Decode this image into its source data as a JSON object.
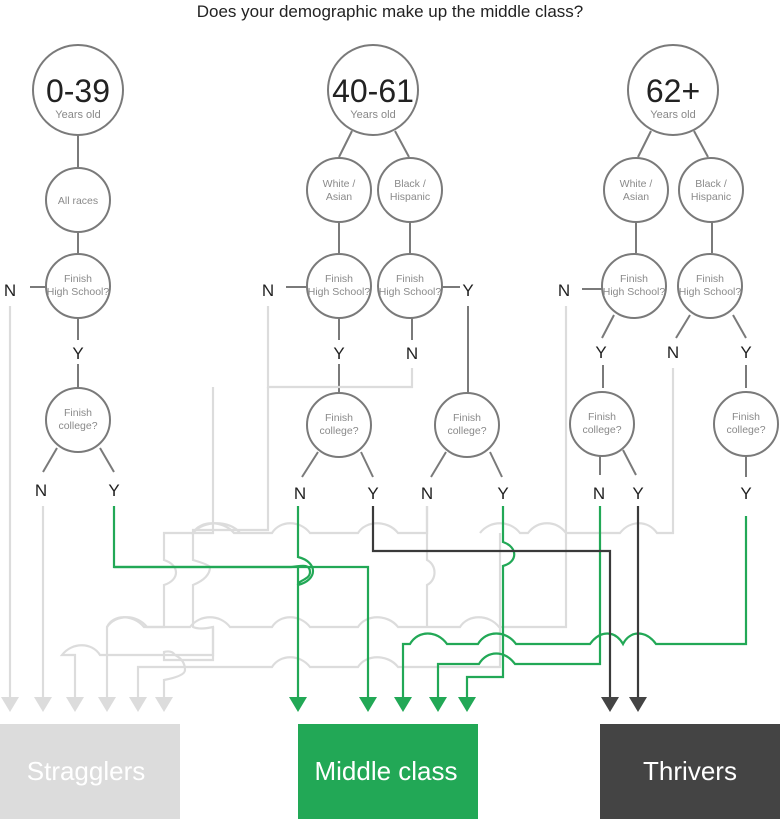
{
  "title": "Does your demographic make up the middle class?",
  "colors": {
    "stragglers": "#dcdcdc",
    "middle_class": "#22a856",
    "thrivers": "#444444",
    "node_stroke": "#7a7a7a"
  },
  "age_groups": [
    {
      "label": "0-39",
      "sub": "Years old"
    },
    {
      "label": "40-61",
      "sub": "Years old"
    },
    {
      "label": "62+",
      "sub": "Years old"
    }
  ],
  "race_nodes": [
    {
      "text": [
        "All races"
      ]
    },
    {
      "text": [
        "White /",
        "Asian"
      ]
    },
    {
      "text": [
        "Black /",
        "Hispanic"
      ]
    },
    {
      "text": [
        "White /",
        "Asian"
      ]
    },
    {
      "text": [
        "Black /",
        "Hispanic"
      ]
    }
  ],
  "question_hs": [
    "Finish",
    "High School?"
  ],
  "question_college": [
    "Finish",
    "college?"
  ],
  "answers": {
    "yes": "Y",
    "no": "N"
  },
  "outcomes": [
    {
      "key": "stragglers",
      "label": "Stragglers"
    },
    {
      "key": "middle_class",
      "label": "Middle class"
    },
    {
      "key": "thrivers",
      "label": "Thrivers"
    }
  ],
  "paths": [
    {
      "group": "0-39",
      "race": "All races",
      "high_school": "N",
      "outcome": "Stragglers"
    },
    {
      "group": "0-39",
      "race": "All races",
      "high_school": "Y",
      "college": "N",
      "outcome": "Stragglers"
    },
    {
      "group": "0-39",
      "race": "All races",
      "high_school": "Y",
      "college": "Y",
      "outcome": "Middle class"
    },
    {
      "group": "40-61",
      "race": "White / Asian",
      "high_school": "N",
      "outcome": "Stragglers"
    },
    {
      "group": "40-61",
      "race": "White / Asian",
      "high_school": "Y",
      "college": "N",
      "outcome": "Middle class"
    },
    {
      "group": "40-61",
      "race": "White / Asian",
      "high_school": "Y",
      "college": "Y",
      "outcome": "Thrivers"
    },
    {
      "group": "40-61",
      "race": "Black / Hispanic",
      "high_school": "N",
      "outcome": "Stragglers"
    },
    {
      "group": "40-61",
      "race": "Black / Hispanic",
      "high_school": "Y",
      "college": "N",
      "outcome": "Stragglers"
    },
    {
      "group": "40-61",
      "race": "Black / Hispanic",
      "high_school": "Y",
      "college": "Y",
      "outcome": "Middle class"
    },
    {
      "group": "62+",
      "race": "White / Asian",
      "high_school": "N",
      "outcome": "Stragglers"
    },
    {
      "group": "62+",
      "race": "White / Asian",
      "high_school": "Y",
      "college": "N",
      "outcome": "Middle class"
    },
    {
      "group": "62+",
      "race": "White / Asian",
      "high_school": "Y",
      "college": "Y",
      "outcome": "Thrivers"
    },
    {
      "group": "62+",
      "race": "Black / Hispanic",
      "high_school": "N",
      "outcome": "Stragglers"
    },
    {
      "group": "62+",
      "race": "Black / Hispanic",
      "high_school": "Y",
      "college": "Y",
      "outcome": "Middle class"
    }
  ]
}
